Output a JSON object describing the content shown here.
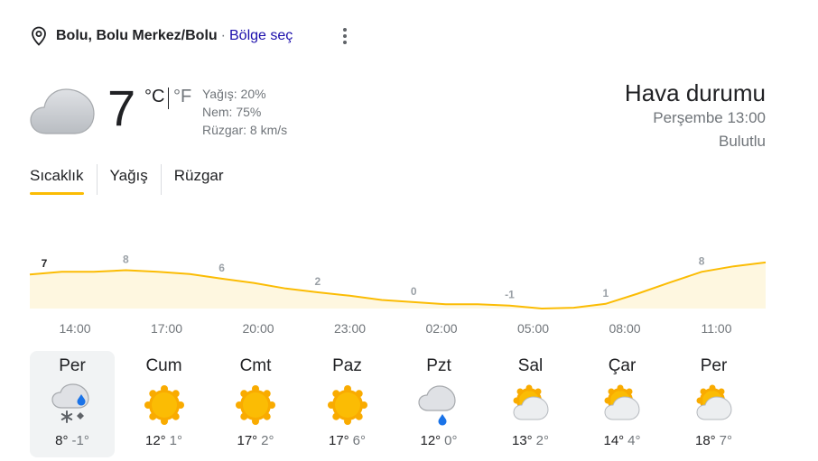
{
  "location": {
    "icon": "location-pin-icon",
    "name": "Bolu, Bolu Merkez/Bolu",
    "separator": "·",
    "region_link": "Bölge seç",
    "more_icon": "more-vert-icon"
  },
  "current": {
    "icon": "cloud-icon",
    "temp": "7",
    "unit_c": "°C",
    "unit_f": "°F",
    "precip": "Yağış: 20%",
    "humidity": "Nem: 75%",
    "wind": "Rüzgar: 8 km/s"
  },
  "side": {
    "title": "Hava durumu",
    "datetime": "Perşembe 13:00",
    "condition": "Bulutlu"
  },
  "tabs": [
    {
      "label": "Sıcaklık",
      "active": true
    },
    {
      "label": "Yağış",
      "active": false
    },
    {
      "label": "Rüzgar",
      "active": false
    }
  ],
  "colors": {
    "accent": "#fbbc04",
    "chart_fill": "#fef7e0",
    "link": "#1a0dab",
    "sun": "#f9ab00",
    "cloud": "#c7cacd"
  },
  "chart_data": {
    "type": "area",
    "x": [
      "13:00",
      "14:00",
      "15:00",
      "16:00",
      "17:00",
      "18:00",
      "19:00",
      "20:00",
      "21:00",
      "22:00",
      "23:00",
      "00:00",
      "01:00",
      "02:00",
      "03:00",
      "04:00",
      "05:00",
      "06:00",
      "07:00",
      "08:00",
      "09:00",
      "10:00",
      "11:00",
      "12:00"
    ],
    "values": [
      7,
      7.6,
      7.6,
      8,
      7.6,
      7.1,
      6,
      5,
      3.7,
      2.8,
      2,
      1,
      0.5,
      0,
      0,
      -0.3,
      -1,
      -0.8,
      0.1,
      2.5,
      5.1,
      7.6,
      8.9,
      9.8
    ],
    "data_labels": [
      {
        "index": 0,
        "text": "7"
      },
      {
        "index": 3,
        "text": "8"
      },
      {
        "index": 6,
        "text": "6"
      },
      {
        "index": 9,
        "text": "2"
      },
      {
        "index": 12,
        "text": "0"
      },
      {
        "index": 15,
        "text": "-1"
      },
      {
        "index": 18,
        "text": "1"
      },
      {
        "index": 21,
        "text": "8"
      }
    ],
    "tick_labels": [
      "14:00",
      "17:00",
      "20:00",
      "23:00",
      "02:00",
      "05:00",
      "08:00",
      "11:00"
    ],
    "ylim": [
      -1,
      10
    ]
  },
  "days": [
    {
      "name": "Per",
      "icon": "snow-rain-icon",
      "hi": "8°",
      "lo": "-1°",
      "selected": true
    },
    {
      "name": "Cum",
      "icon": "sun-icon",
      "hi": "12°",
      "lo": "1°",
      "selected": false
    },
    {
      "name": "Cmt",
      "icon": "sun-icon",
      "hi": "17°",
      "lo": "2°",
      "selected": false
    },
    {
      "name": "Paz",
      "icon": "sun-icon",
      "hi": "17°",
      "lo": "6°",
      "selected": false
    },
    {
      "name": "Pzt",
      "icon": "rain-icon",
      "hi": "12°",
      "lo": "0°",
      "selected": false
    },
    {
      "name": "Sal",
      "icon": "partly-cloudy-icon",
      "hi": "13°",
      "lo": "2°",
      "selected": false
    },
    {
      "name": "Çar",
      "icon": "partly-cloudy-icon",
      "hi": "14°",
      "lo": "4°",
      "selected": false
    },
    {
      "name": "Per",
      "icon": "partly-cloudy-icon",
      "hi": "18°",
      "lo": "7°",
      "selected": false
    }
  ]
}
